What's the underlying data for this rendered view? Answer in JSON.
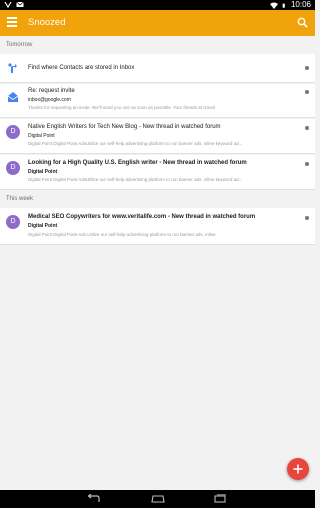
{
  "status_bar": {
    "time": "10:06",
    "icons": [
      "notification-icon",
      "email-notification-icon",
      "wifi-icon",
      "battery-icon"
    ]
  },
  "app_bar": {
    "title": "Snoozed",
    "color": "#f0a30a",
    "menu_icon": "menu-icon",
    "search_icon": "search-icon"
  },
  "sections": [
    {
      "header": "Tomorrow",
      "items": [
        {
          "icon": "inbox-hand-icon",
          "title": "Find where Contacts are stored in Inbox",
          "sender": "",
          "snippet": ""
        },
        {
          "icon": "envelope-icon",
          "title": "Re: request invite",
          "sender": "inbox@google.com",
          "snippet": "Thanks for requesting an invite. We'll send you one as soon as possible. Your friends at Gmail"
        },
        {
          "avatar": "D",
          "title": "Native English Writers for Tech New Blog - New thread in watched forum",
          "sender": "Digital Point",
          "snippet": "Digital Point Digital Point AdsUtilize our self-help advertising platform to run banner ads, inline keyword ad..."
        },
        {
          "avatar": "D",
          "title": "Looking for a High Quality U.S. English writer - New thread in watched forum",
          "sender": "Digital Point",
          "snippet": "Digital Point Digital Point AdsUtilize our self-help advertising platform to run banner ads, inline keyword ad..."
        }
      ]
    },
    {
      "header": "This week",
      "items": [
        {
          "avatar": "D",
          "title": "Medical SEO Copywriters for www.veritalife.com - New thread in watched forum",
          "sender": "Digital Point",
          "snippet": "Digital Point Digital Point Ads Utilize our self-help advertising platform to run banner ads, inline"
        }
      ]
    }
  ],
  "fab": {
    "label": "+",
    "color": "#e8453c"
  },
  "nav_bar": {
    "buttons": [
      "back-icon",
      "home-icon",
      "recents-icon"
    ]
  }
}
